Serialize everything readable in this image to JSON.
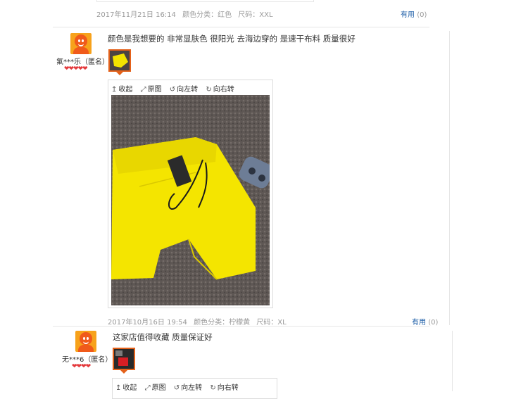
{
  "review0": {
    "date": "2017年11月21日 16:14",
    "color_label": "颜色分类：红色",
    "size_label": "尺码：XXL",
    "useful_label": "有用",
    "useful_count": "(0)"
  },
  "review1": {
    "username": "氟***乐（匿名）",
    "hearts": "❤❤❤❤❤",
    "comment": "颜色是我想要的 非常显肤色 很阳光 去海边穿的 是速干布料 质量很好",
    "toolbar": {
      "collapse": "收起",
      "original": "原图",
      "rotate_left": "向左转",
      "rotate_right": "向右转"
    },
    "date": "2017年10月16日 19:54",
    "color_label": "颜色分类：柠檬黄",
    "size_label": "尺码：XL",
    "useful_label": "有用",
    "useful_count": "(0)"
  },
  "review2": {
    "username": "无***6（匿名）",
    "hearts": "❤❤❤❤",
    "comment": "这家店值得收藏 质量保证好",
    "toolbar": {
      "collapse": "收起",
      "original": "原图",
      "rotate_left": "向左转",
      "rotate_right": "向右转"
    }
  },
  "icons": {
    "collapse": "collapse-icon",
    "original": "fullscreen-icon",
    "rotate_left": "rotate-left-icon",
    "rotate_right": "rotate-right-icon"
  },
  "colors": {
    "accent": "#e4611a",
    "link": "#1f5fa8",
    "heart": "#e4393c"
  }
}
